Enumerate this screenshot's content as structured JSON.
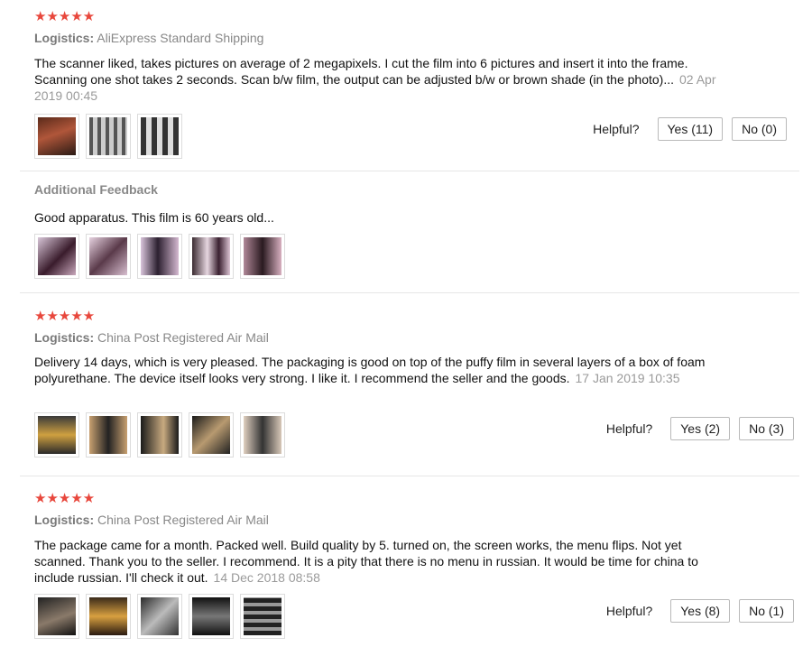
{
  "reviews": [
    {
      "stars": "★★★★★",
      "logistics_label": "Logistics:",
      "logistics_value": "AliExpress Standard Shipping",
      "text": "The scanner liked, takes pictures on average of 2 megapixels. I cut the film into 6 pictures and insert it into the frame. Scanning one shot takes 2 seconds. Scan b/w film, the output can be adjusted b/w or brown shade (in the photo)...",
      "date": "02 Apr 2019 00:45",
      "helpful_label": "Helpful?",
      "yes_label": "Yes (11)",
      "no_label": "No (0)",
      "additional_title": "Additional Feedback",
      "additional_text": "Good apparatus. This film is 60 years old..."
    },
    {
      "stars": "★★★★★",
      "logistics_label": "Logistics:",
      "logistics_value": "China Post Registered Air Mail",
      "text": "Delivery 14 days, which is very pleased. The packaging is good on top of the puffy film in several layers of a box of foam polyurethane. The device itself looks very strong. I like it. I recommend the seller and the goods.",
      "date": "17 Jan 2019 10:35",
      "helpful_label": "Helpful?",
      "yes_label": "Yes (2)",
      "no_label": "No (3)"
    },
    {
      "stars": "★★★★★",
      "logistics_label": "Logistics:",
      "logistics_value": "China Post Registered Air Mail",
      "text": "The package came for a month. Packed well. Build quality by 5. turned on, the screen works, the menu flips. Not yet scanned. Thank you to the seller. I recommend. It is a pity that there is no menu in russian. It would be time for china to include russian. I'll check it out.",
      "date": "14 Dec 2018 08:58",
      "helpful_label": "Helpful?",
      "yes_label": "Yes (8)",
      "no_label": "No (1)"
    }
  ],
  "colors": {
    "star": "#e8473c",
    "muted": "#888888",
    "divider": "#e6e6e6"
  }
}
